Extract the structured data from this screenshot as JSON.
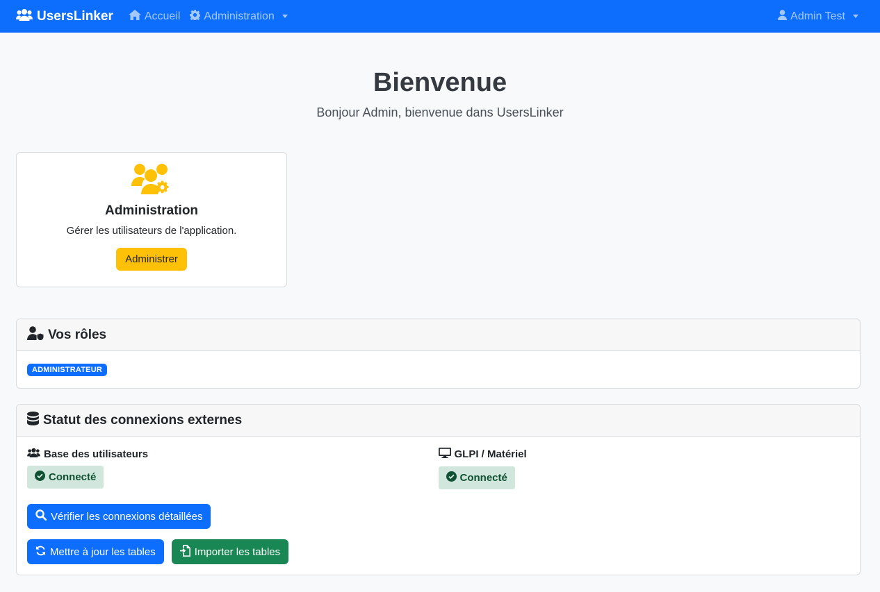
{
  "navbar": {
    "brand": "UsersLinker",
    "items": [
      {
        "label": "Accueil",
        "icon": "home-icon"
      },
      {
        "label": "Administration",
        "icon": "gear-icon"
      }
    ],
    "user": "Admin Test"
  },
  "hero": {
    "title": "Bienvenue",
    "subtitle": "Bonjour Admin, bienvenue dans UsersLinker"
  },
  "admin_card": {
    "icon": "users-gear-icon",
    "title": "Administration",
    "description": "Gérer les utilisateurs de l'application.",
    "button": "Administrer"
  },
  "roles_panel": {
    "title": "Vos rôles",
    "icon": "user-shield-icon",
    "badges": [
      "ADMINISTRATEUR"
    ]
  },
  "connections_panel": {
    "title": "Statut des connexions externes",
    "icon": "database-icon",
    "connections": [
      {
        "name": "Base des utilisateurs",
        "icon": "users-icon",
        "status": "Connecté"
      },
      {
        "name": "GLPI / Matériel",
        "icon": "desktop-icon",
        "status": "Connecté"
      }
    ],
    "buttons": {
      "verify": "Vérifier les connexions détaillées",
      "update": "Mettre à jour les tables",
      "import": "Importer les tables"
    }
  },
  "colors": {
    "primary": "#0d6efd",
    "warning": "#ffc107",
    "success": "#198754",
    "success_bg": "#d1e7dd",
    "success_text": "#0f5132"
  }
}
